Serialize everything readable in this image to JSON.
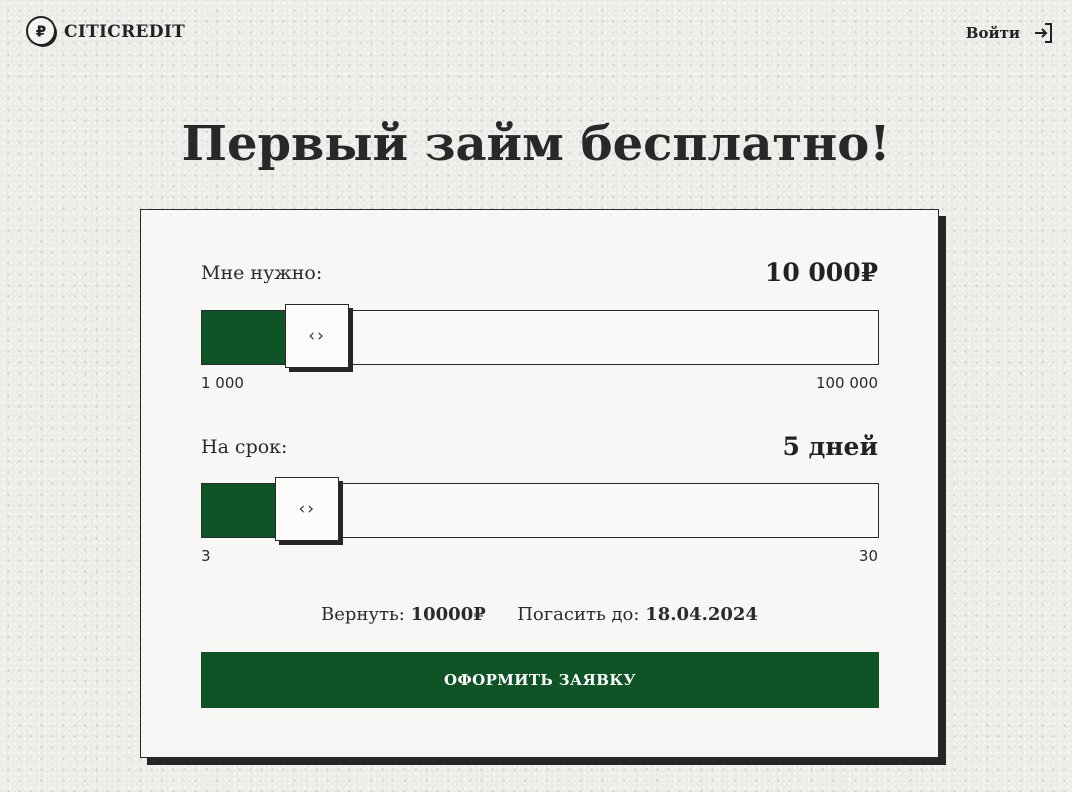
{
  "header": {
    "brand": "CITICREDIT",
    "logo_icon": "ruble-coin-icon",
    "login_label": "Войти",
    "login_icon": "login-arrow-icon"
  },
  "hero": {
    "title": "Первый займ бесплатно!"
  },
  "calculator": {
    "amount": {
      "label": "Мне нужно:",
      "value_display": "10 000₽",
      "value": 10000,
      "min": 1000,
      "max": 100000,
      "min_label": "1 000",
      "max_label": "100 000",
      "thumb_glyph": "‹›"
    },
    "term": {
      "label": "На срок:",
      "value_display": "5 дней",
      "value": 5,
      "min": 3,
      "max": 30,
      "min_label": "3",
      "max_label": "30",
      "thumb_glyph": "‹›"
    },
    "summary": {
      "return_label": "Вернуть:",
      "return_value": "10000₽",
      "due_label": "Погасить до:",
      "due_value": "18.04.2024"
    },
    "submit_label": "ОФОРМИТЬ ЗАЯВКУ"
  },
  "colors": {
    "accent_green": "#0e5427",
    "background": "#e9ece7",
    "card": "#f7f8f5",
    "text": "#262626"
  }
}
